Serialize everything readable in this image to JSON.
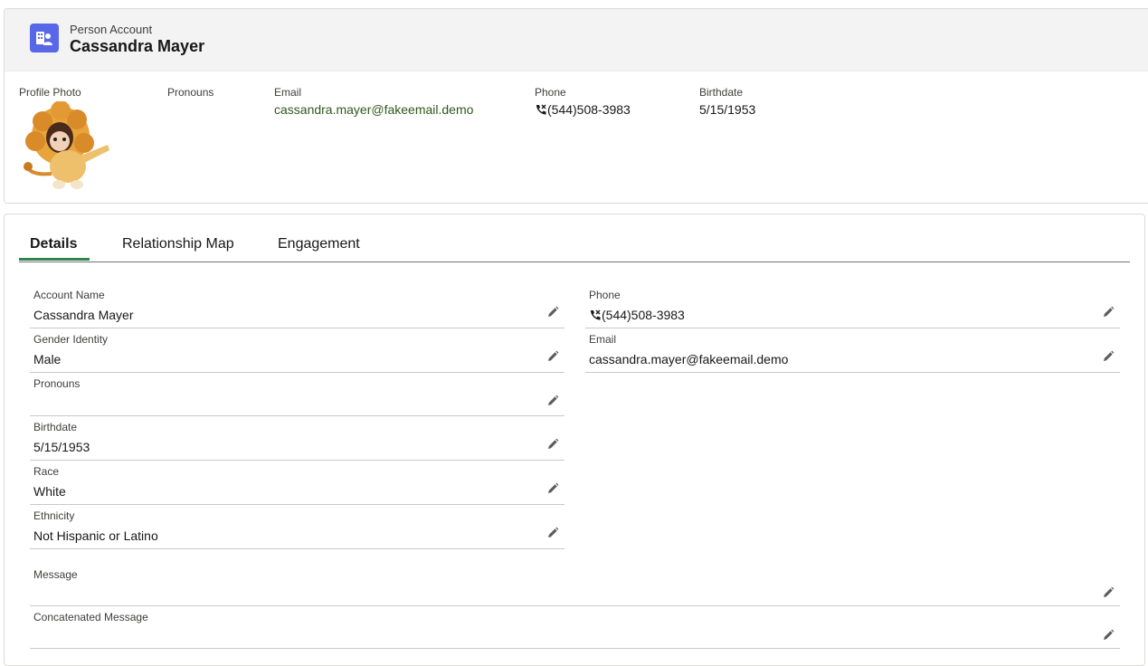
{
  "header": {
    "object_type": "Person Account",
    "record_name": "Cassandra Mayer",
    "object_icon": "person-account-icon"
  },
  "highlights": {
    "profile_photo_label": "Profile Photo",
    "pronouns_label": "Pronouns",
    "email_label": "Email",
    "email_value": "cassandra.mayer@fakeemail.demo",
    "phone_label": "Phone",
    "phone_value": "(544)508-3983",
    "birthdate_label": "Birthdate",
    "birthdate_value": "5/15/1953"
  },
  "tabs": [
    {
      "label": "Details",
      "active": true
    },
    {
      "label": "Relationship Map",
      "active": false
    },
    {
      "label": "Engagement",
      "active": false
    }
  ],
  "details": {
    "account_name": {
      "label": "Account Name",
      "value": "Cassandra Mayer"
    },
    "gender_identity": {
      "label": "Gender Identity",
      "value": "Male"
    },
    "pronouns": {
      "label": "Pronouns",
      "value": ""
    },
    "birthdate": {
      "label": "Birthdate",
      "value": "5/15/1953"
    },
    "race": {
      "label": "Race",
      "value": "White"
    },
    "ethnicity": {
      "label": "Ethnicity",
      "value": "Not Hispanic or Latino"
    },
    "phone": {
      "label": "Phone",
      "value": "(544)508-3983"
    },
    "email": {
      "label": "Email",
      "value": "cassandra.mayer@fakeemail.demo"
    },
    "message": {
      "label": "Message",
      "value": ""
    },
    "concatenated_message": {
      "label": "Concatenated Message",
      "value": ""
    }
  },
  "colors": {
    "brand_icon": "#5867e8",
    "link": "#2e5a1c",
    "tab_active": "#2e844a"
  }
}
